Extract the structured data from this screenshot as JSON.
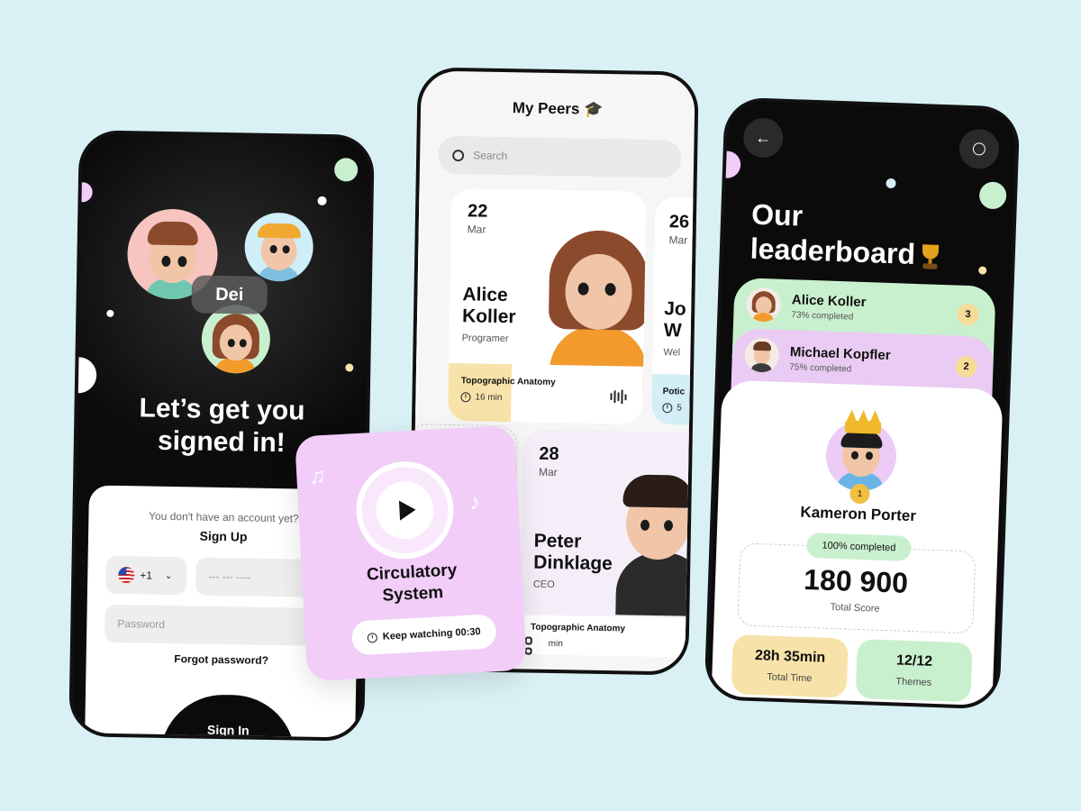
{
  "colors": {
    "background": "#d9f1f5",
    "dark": "#0b0b0b",
    "mint": "#c9f0ce",
    "lilac": "#f1cdf8",
    "butter": "#f7e3a9",
    "sky": "#d3eef5"
  },
  "signin": {
    "avatar_label": "Dei",
    "title_line1": "Let’s get you",
    "title_line2": "signed in!",
    "no_account": "You don't have an account yet?",
    "sign_up": "Sign Up",
    "country_code": "+1",
    "phone_placeholder": "--- --- ----",
    "password_placeholder": "Password",
    "forgot": "Forgot password?",
    "sign_in": "Sign In"
  },
  "peers": {
    "title": "My Peers 🎓",
    "search_placeholder": "Search",
    "cards": [
      {
        "day": "22",
        "month": "Mar",
        "first": "Alice",
        "last": "Koller",
        "role": "Programer",
        "lesson": "Topographic Anatomy",
        "time": "16 min"
      },
      {
        "day": "26",
        "month": "Mar",
        "first": "Jo",
        "last": "W",
        "role": "Wel",
        "lesson": "Potic",
        "time": "5"
      },
      {
        "day": "28",
        "month": "Mar",
        "first": "Peter",
        "last": "Dinklage",
        "role": "CEO",
        "lesson": "Topographic Anatomy",
        "time": "min"
      }
    ]
  },
  "video": {
    "title_line1": "Circulatory",
    "title_line2": "System",
    "keep_watching": "Keep watching 00:30"
  },
  "leaderboard": {
    "back_icon": "←",
    "title_line1": "Our",
    "title_line2": "leaderboard",
    "ranks": [
      {
        "name": "Alice Koller",
        "completed": "73% completed",
        "rank": "3"
      },
      {
        "name": "Michael Kopfler",
        "completed": "75% completed",
        "rank": "2"
      }
    ],
    "winner": {
      "name": "Kameron Porter",
      "rank": "1",
      "completed": "100% completed",
      "score": "180 900",
      "score_label": "Total Score",
      "time_value": "28h 35min",
      "time_label": "Total Time",
      "themes_value": "12/12",
      "themes_label": "Themes"
    }
  }
}
